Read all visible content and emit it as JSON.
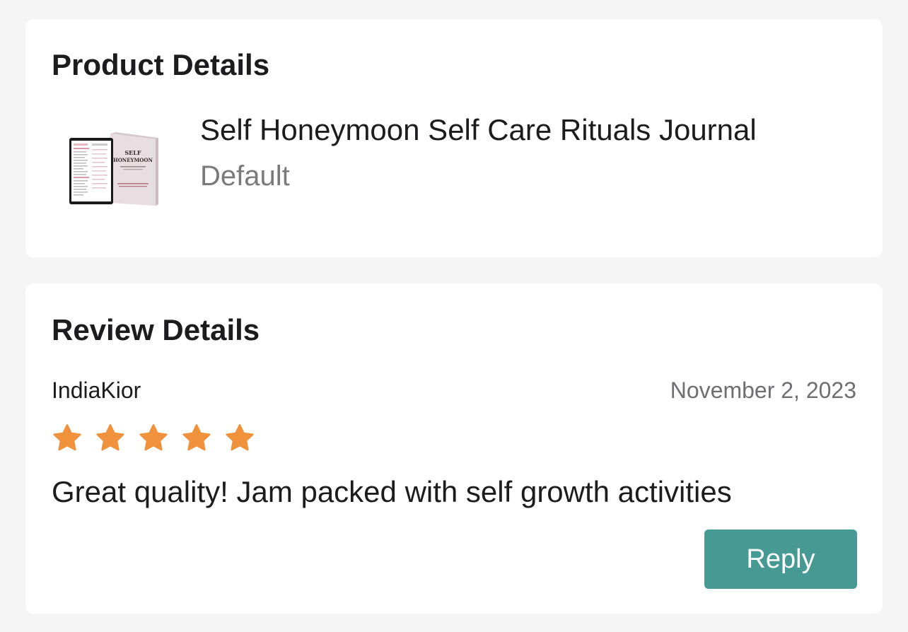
{
  "product": {
    "title": "Product Details",
    "name": "Self Honeymoon Self Care Rituals Journal",
    "variant": "Default",
    "thumbnail_icon": "journal-product-image"
  },
  "review": {
    "title": "Review Details",
    "reviewer": "IndiaKior",
    "date": "November 2, 2023",
    "rating": 5,
    "rating_max": 5,
    "text": "Great quality! Jam packed with self growth activities",
    "reply_label": "Reply"
  },
  "colors": {
    "star": "#f0923b",
    "reply_button": "#479a94",
    "page_background": "#f5f5f5",
    "card_background": "#ffffff"
  }
}
